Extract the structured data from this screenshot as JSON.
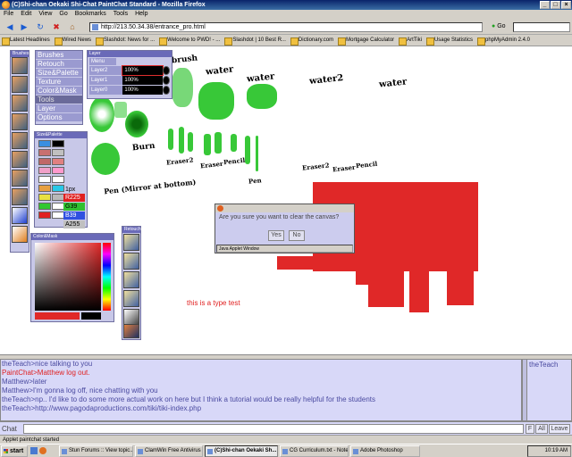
{
  "window": {
    "title": "(C)Shi-chan Oekaki Shi-Chat PaintChat Standard - Mozilla Firefox"
  },
  "menu": [
    "File",
    "Edit",
    "View",
    "Go",
    "Bookmarks",
    "Tools",
    "Help"
  ],
  "nav": {
    "url": "http://213.50.34.38/entrance_pro.html",
    "go_label": "Go"
  },
  "bookmarks": [
    "Latest Headlines",
    "Wired News",
    "Slashdot: News for ...",
    "Welcome to PWD! - ...",
    "Slashdot | 10 Best R...",
    "Dictionary.com",
    "Mortgage Calculator",
    "ArtTiki",
    "Usage Statistics",
    "phpMyAdmin 2.4.0"
  ],
  "brushes_panel": {
    "title": "Brushes",
    "items": [
      "Brushes",
      "Retouch",
      "Size&Palette",
      "Texture",
      "Color&Mask",
      "Tools",
      "Layer",
      "Options"
    ],
    "selected_index": 5
  },
  "layer_panel": {
    "title": "Layer",
    "menu_label": "Menu",
    "layers": [
      {
        "name": "Layer2",
        "opacity": "100%"
      },
      {
        "name": "Layer1",
        "opacity": "100%"
      },
      {
        "name": "Layer0",
        "opacity": "100%"
      }
    ]
  },
  "size_palette": {
    "title": "Size&Palette",
    "size_label": "1px",
    "r": "R225",
    "g": "G39",
    "b": "B39",
    "a": "A255",
    "swatches": [
      "#3a8fe0",
      "#000000",
      "#c87070",
      "#c0c0c0",
      "#c06868",
      "#e08080",
      "#f0a0c8",
      "#ff99cc",
      "#ffffff",
      "#ffffff",
      "#e8a040",
      "#28c8e8",
      "#e8e040",
      "#b8b8b8",
      "#30c830",
      "#ffffff",
      "#e02020",
      "#ffffff"
    ]
  },
  "color_mask": {
    "title": "Color&Mask"
  },
  "retouch_panel": {
    "title": "Retouch"
  },
  "canvas_text": {
    "type_test": "this is a type test",
    "brush": "brush",
    "water_1": "water",
    "water_2": "water",
    "water_3": "water2",
    "water_4": "water",
    "burn": "Burn",
    "eraser_1": "Eraser2",
    "eraser_2": "Eraser",
    "pencil_1": "Pencil",
    "pen": "Pen",
    "eraser_3": "Eraser2",
    "eraser_4": "Eraser",
    "pencil_2": "Pencil",
    "mirror": "Pen (Mirror at bottom)"
  },
  "dialog": {
    "message": "Are you sure you want to clear the canvas?",
    "yes_label": "Yes",
    "no_label": "No",
    "status": "Java Applet Window"
  },
  "chat": {
    "lines": [
      {
        "text": "theTeach>nice talking to you",
        "color": "normal"
      },
      {
        "text": "PaintChat>Matthew log out.",
        "color": "red"
      },
      {
        "text": "Matthew>later",
        "color": "normal"
      },
      {
        "text": "Matthew>I'm gonna log off, nice chatting with you",
        "color": "normal"
      },
      {
        "text": "theTeach>np.. I'd like to do some more actual work on here but I think a tutorial would be really helpful for the students",
        "color": "normal"
      },
      {
        "text": "theTeach>http://www.pagodaproductions.com/tiki/tiki-index.php",
        "color": "normal"
      }
    ],
    "users": [
      "theTeach"
    ],
    "input_label": "Chat",
    "buttons": {
      "f": "F",
      "all": "All",
      "leave": "Leave"
    }
  },
  "status_bar": "Applet paintchat started",
  "taskbar": {
    "start_label": "start",
    "tasks": [
      "Stun Forums :: View topic...",
      "ClamWin Free Antivirus",
      "(C)Shi-chan Oekaki Sh...",
      "CG Curriculum.txt - Notepad",
      "Adobe Photoshop"
    ],
    "active_index": 2,
    "clock": "10:19 AM"
  },
  "colors": {
    "paint_green": "#38c838",
    "paint_red": "#e02828",
    "panel_bg": "#c8c8e8",
    "panel_title": "#6a6ab8",
    "chat_bg": "#d8d8f8"
  }
}
